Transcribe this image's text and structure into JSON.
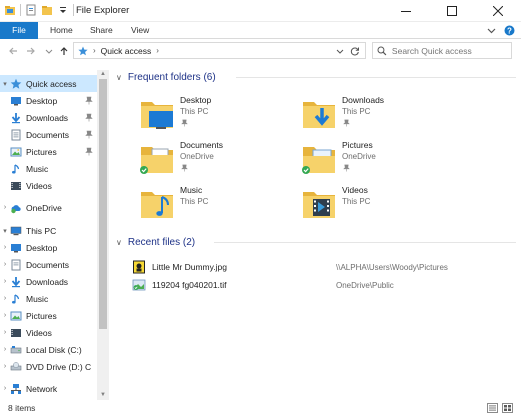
{
  "window": {
    "title": "File Explorer"
  },
  "colors": {
    "accent": "#1979ca",
    "selected": "#cce8ff",
    "group_header": "#1e3287"
  },
  "ribbon": {
    "tabs": [
      {
        "label": "File"
      },
      {
        "label": "Home"
      },
      {
        "label": "Share"
      },
      {
        "label": "View"
      }
    ]
  },
  "address": {
    "breadcrumb": "Quick access",
    "search_placeholder": "Search Quick access"
  },
  "navigation": {
    "quick_access": "Quick access",
    "qa_items": [
      "Desktop",
      "Downloads",
      "Documents",
      "Pictures",
      "Music",
      "Videos"
    ],
    "onedrive": "OneDrive",
    "this_pc": "This PC",
    "pc_items": [
      "Desktop",
      "Documents",
      "Downloads",
      "Music",
      "Pictures",
      "Videos",
      "Local Disk (C:)",
      "DVD Drive (D:) C"
    ],
    "network": "Network"
  },
  "frequent": {
    "header": "Frequent folders (6)",
    "folders": [
      {
        "name": "Desktop",
        "location": "This PC",
        "icon": "desktop-folder-icon"
      },
      {
        "name": "Downloads",
        "location": "This PC",
        "icon": "downloads-folder-icon"
      },
      {
        "name": "Documents",
        "location": "OneDrive",
        "icon": "documents-folder-icon"
      },
      {
        "name": "Pictures",
        "location": "OneDrive",
        "icon": "pictures-folder-icon"
      },
      {
        "name": "Music",
        "location": "This PC",
        "icon": "music-folder-icon"
      },
      {
        "name": "Videos",
        "location": "This PC",
        "icon": "videos-folder-icon"
      }
    ]
  },
  "recent": {
    "header": "Recent files (2)",
    "files": [
      {
        "name": "Little Mr Dummy.jpg",
        "location": "\\\\ALPHA\\Users\\Woody\\Pictures",
        "icon": "jpg-file-icon"
      },
      {
        "name": "119204 fg040201.tif",
        "location": "OneDrive\\Public",
        "icon": "tif-file-icon"
      }
    ]
  },
  "status": {
    "count": "8 items"
  }
}
